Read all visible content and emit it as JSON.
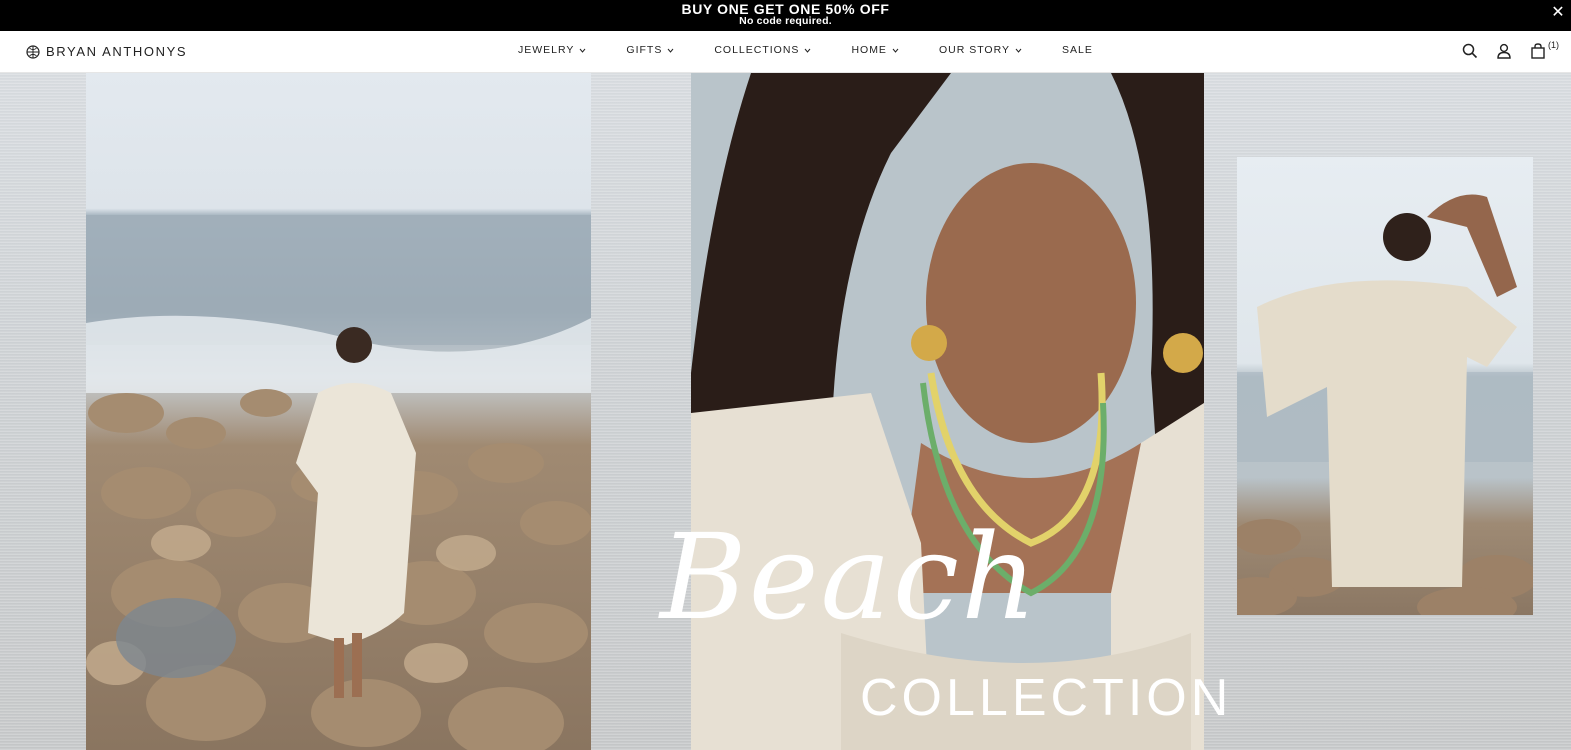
{
  "promo": {
    "headline": "BUY ONE GET ONE 50% OFF",
    "subline": "No code required.",
    "close_label": "✕"
  },
  "header": {
    "brand": "BRYAN ANTHONYS",
    "nav": [
      {
        "label": "JEWELRY",
        "has_dropdown": true
      },
      {
        "label": "GIFTS",
        "has_dropdown": true
      },
      {
        "label": "COLLECTIONS",
        "has_dropdown": true
      },
      {
        "label": "HOME",
        "has_dropdown": true
      },
      {
        "label": "OUR STORY",
        "has_dropdown": true
      },
      {
        "label": "SALE",
        "has_dropdown": false
      }
    ],
    "icons": [
      "search-icon",
      "account-icon",
      "bag-icon"
    ],
    "cart_count": "(1)"
  },
  "hero": {
    "script_title": "Beach",
    "subtitle": "COLLECTION"
  },
  "colors": {
    "promo_bg": "#000000",
    "promo_text": "#ffffff",
    "nav_text": "#222222",
    "hero_text": "#ffffff"
  }
}
